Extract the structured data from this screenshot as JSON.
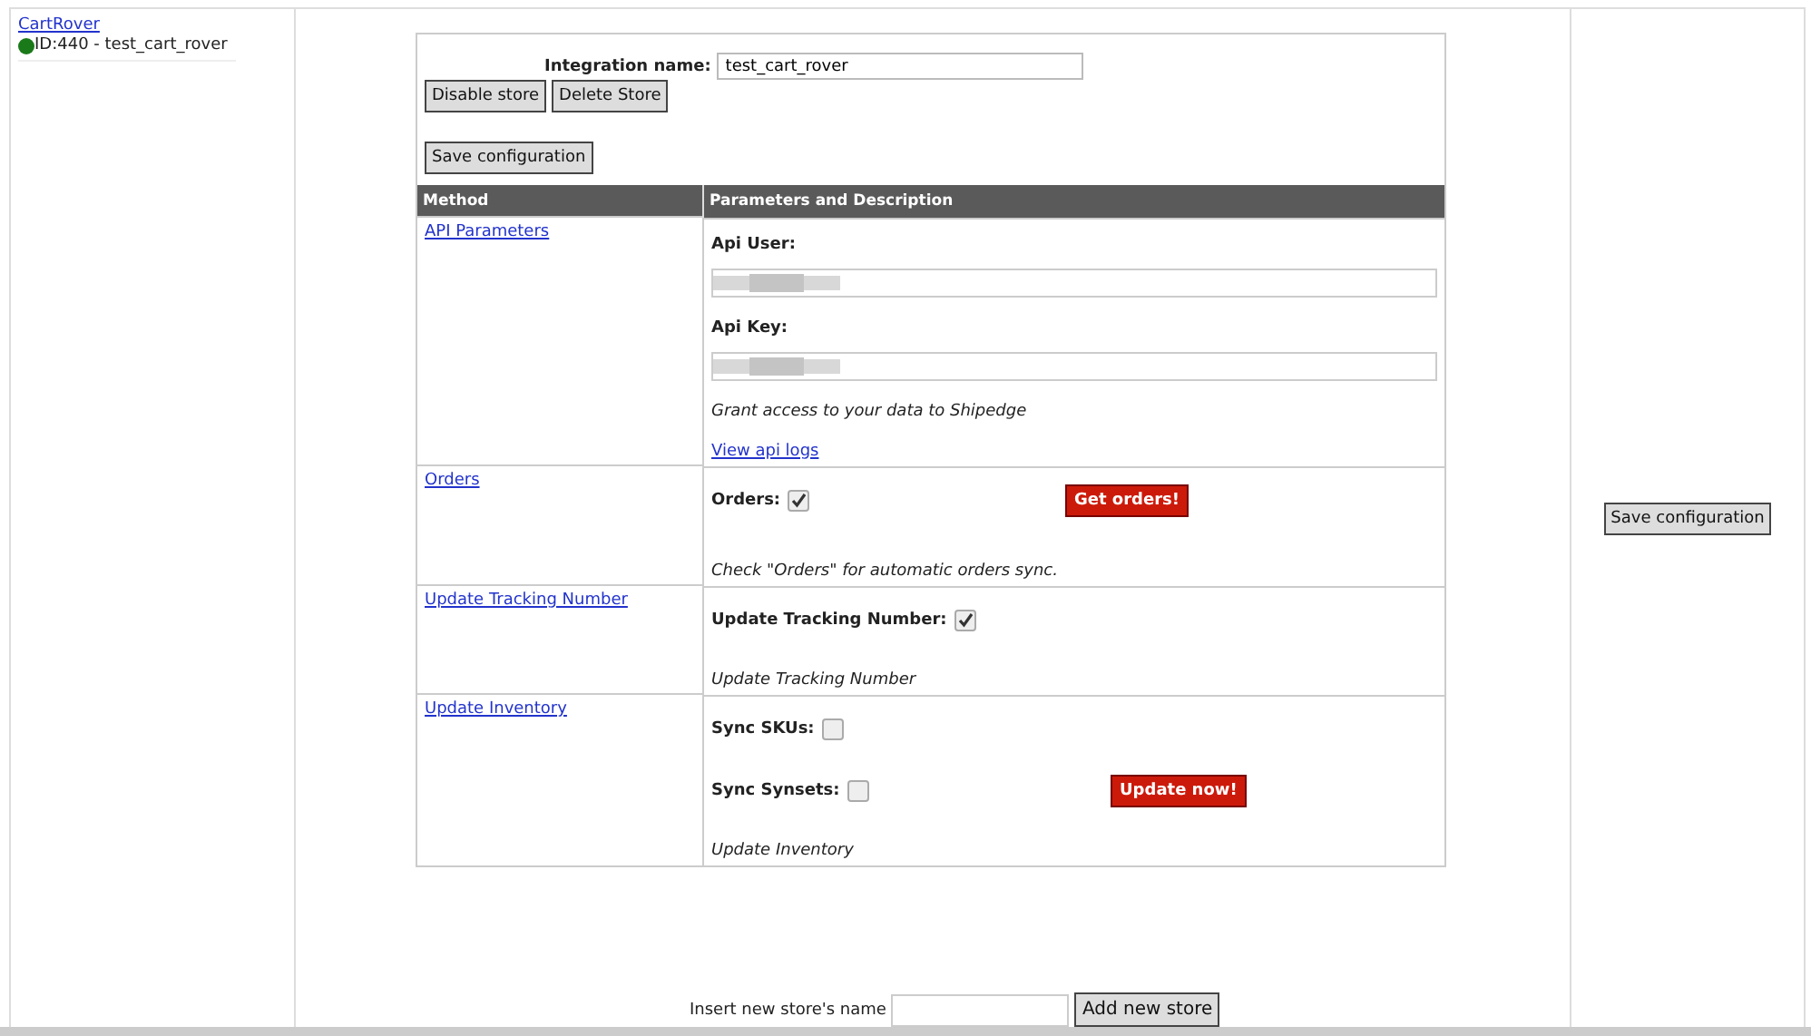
{
  "sidebar": {
    "store_link": "CartRover",
    "store_status": {
      "color": "#1a7a1a",
      "text": "ID:440 - test_cart_rover"
    }
  },
  "store_form": {
    "integration_label": "Integration name:",
    "integration_value": "test_cart_rover",
    "buttons": [
      "Disable store",
      "Delete Store"
    ],
    "save_button": "Save configuration"
  },
  "table": {
    "columns": [
      "Method",
      "Parameters and Description"
    ],
    "rows": [
      {
        "method": "API Parameters",
        "params": [
          {
            "kind": "field",
            "label": "Api User:"
          },
          {
            "kind": "field",
            "label": "Api Key:"
          },
          {
            "kind": "note",
            "text": "Grant access to your data to Shipedge"
          },
          {
            "kind": "link",
            "text": "View api logs"
          }
        ]
      },
      {
        "method": "Orders",
        "params": [
          {
            "kind": "checkbox",
            "label": "Orders:",
            "checked": true,
            "action": "Get orders!"
          },
          {
            "kind": "note",
            "text": "Check \"Orders\" for automatic orders sync."
          }
        ]
      },
      {
        "method": "Update Tracking Number",
        "params": [
          {
            "kind": "checkbox",
            "label": "Update Tracking Number:",
            "checked": true
          },
          {
            "kind": "note",
            "text": "Update Tracking Number"
          }
        ]
      },
      {
        "method": "Update Inventory",
        "params": [
          {
            "kind": "checkbox",
            "label": "Sync SKUs:",
            "checked": false
          },
          {
            "kind": "checkbox",
            "label": "Sync Synsets:",
            "checked": false,
            "action": "Update now!"
          },
          {
            "kind": "note",
            "text": "Update Inventory"
          }
        ]
      }
    ]
  },
  "new_store": {
    "label": "Insert new store's name",
    "button": "Add new store"
  },
  "right_panel": {
    "save_button": "Save configuration"
  }
}
